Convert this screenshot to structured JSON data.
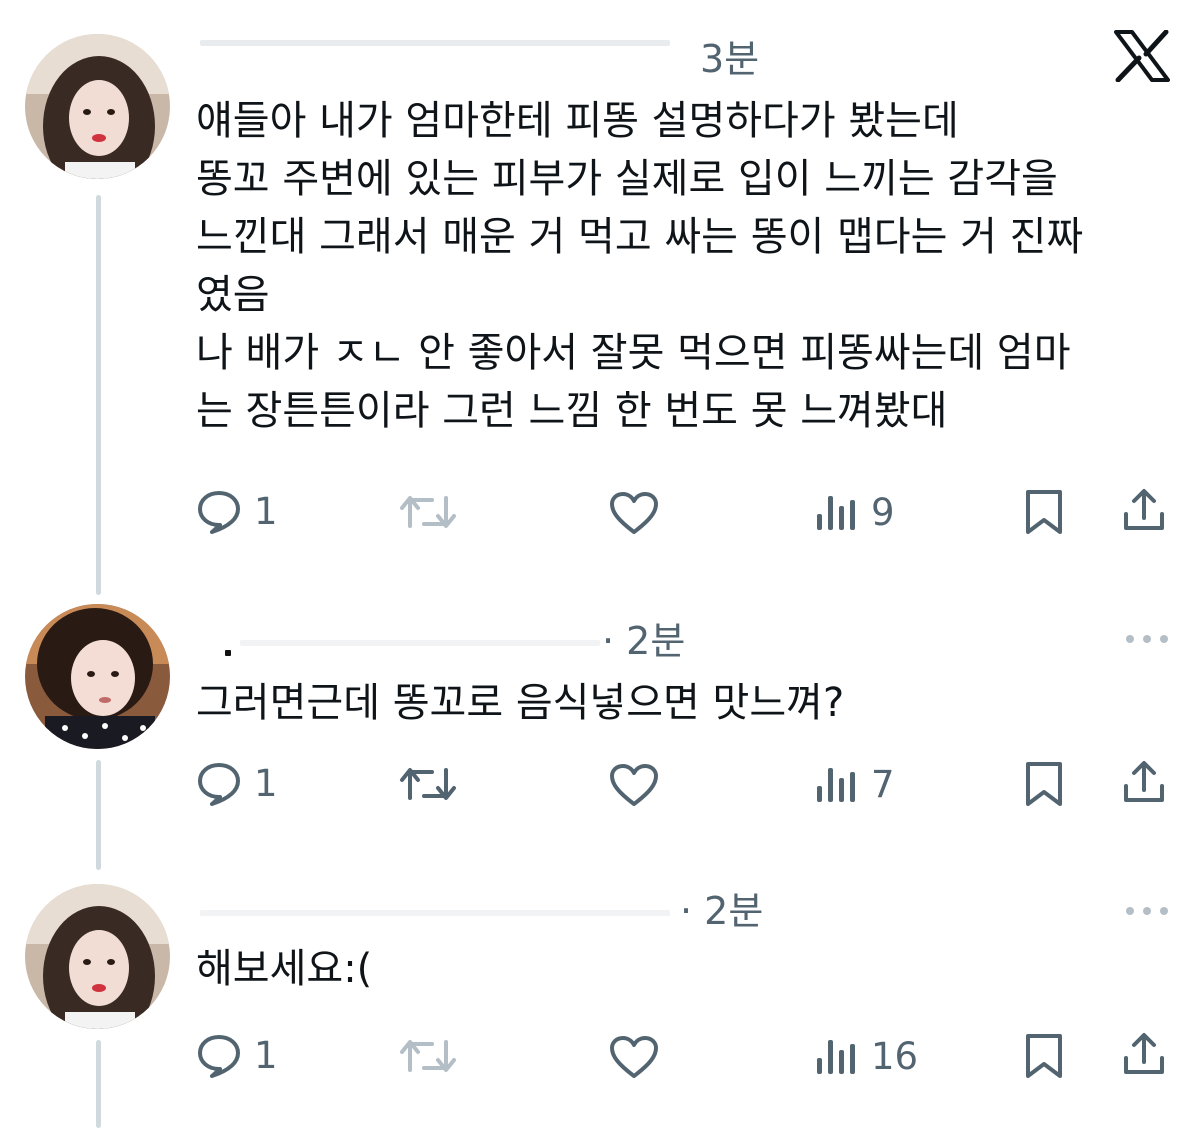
{
  "brand": {
    "logo_icon": "x-logo-icon",
    "text_color": "#0f1419",
    "muted_color": "#536471",
    "thread_line_color": "#cfd9de"
  },
  "tweets": [
    {
      "time": "3분",
      "lines": [
        "얘들아 내가 엄마한테 피똥 설명하다가 봤는데",
        "똥꼬 주변에 있는 피부가 실제로 입이 느끼는 감각을",
        "느낀대 그래서 매운 거 먹고 싸는 똥이 맵다는 거 진짜",
        "였음",
        "나 배가 ㅈㄴ 안 좋아서 잘못 먹으면 피똥싸는데 엄마",
        "는 장튼튼이라 그런 느낌 한 번도 못 느껴봤대"
      ],
      "reply_count": "1",
      "view_count": "9"
    },
    {
      "time": "· 2분",
      "lines": [
        "그러면근데 똥꼬로 음식넣으면 맛느껴?"
      ],
      "reply_count": "1",
      "view_count": "7"
    },
    {
      "time": "· 2분",
      "lines": [
        "해보세요:("
      ],
      "reply_count": "1",
      "view_count": "16"
    }
  ]
}
